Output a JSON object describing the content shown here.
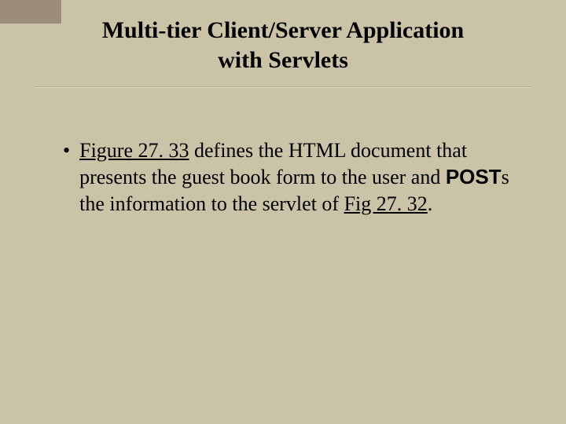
{
  "title": {
    "line1": "Multi-tier Client/Server Application",
    "line2": "with Servlets"
  },
  "bullet": {
    "link1": "Figure 27. 33",
    "t1": " defines the HTML document that presents the guest book form to the user and ",
    "bold": "POST",
    "t2": "s the information to the servlet of ",
    "link2": "Fig 27. 32",
    "t3": "."
  }
}
